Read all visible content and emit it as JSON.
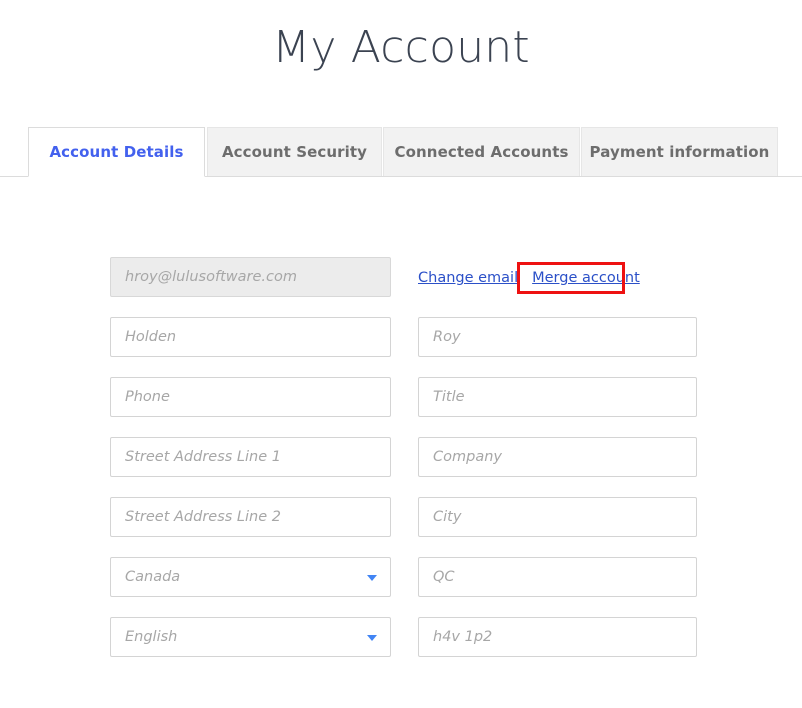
{
  "page": {
    "title": "My Account"
  },
  "tabs": [
    {
      "label": "Account Details",
      "active": true
    },
    {
      "label": "Account Security",
      "active": false
    },
    {
      "label": "Connected Accounts",
      "active": false
    },
    {
      "label": "Payment information",
      "active": false
    }
  ],
  "account_form": {
    "email_field": {
      "placeholder": "hroy@lulusoftware.com",
      "value": "",
      "disabled": true
    },
    "links": {
      "change_email": "Change email",
      "merge_account": "Merge account"
    },
    "left_column": [
      {
        "name": "first-name",
        "placeholder": "Holden",
        "value": "",
        "type": "text"
      },
      {
        "name": "phone",
        "placeholder": "Phone",
        "value": "",
        "type": "text"
      },
      {
        "name": "street-address-1",
        "placeholder": "Street Address Line 1",
        "value": "",
        "type": "text"
      },
      {
        "name": "street-address-2",
        "placeholder": "Street Address Line 2",
        "value": "",
        "type": "text"
      },
      {
        "name": "country",
        "placeholder": "Canada",
        "value": "",
        "type": "select"
      },
      {
        "name": "language",
        "placeholder": "English",
        "value": "",
        "type": "select"
      }
    ],
    "right_column": [
      {
        "name": "last-name",
        "placeholder": "Roy",
        "value": "",
        "type": "text"
      },
      {
        "name": "title",
        "placeholder": "Title",
        "value": "",
        "type": "text"
      },
      {
        "name": "company",
        "placeholder": "Company",
        "value": "",
        "type": "text"
      },
      {
        "name": "city",
        "placeholder": "City",
        "value": "",
        "type": "text"
      },
      {
        "name": "province",
        "placeholder": "QC",
        "value": "",
        "type": "text"
      },
      {
        "name": "postal-code",
        "placeholder": "h4v 1p2",
        "value": "",
        "type": "text"
      }
    ]
  },
  "annotation": {
    "target": "merge-account-link",
    "color": "#ee1111"
  },
  "colors": {
    "active_tab_text": "#4361ee",
    "inactive_tab_text": "#6d6d6d",
    "inactive_tab_bg": "#f2f2f2",
    "link": "#2b50c8",
    "placeholder": "#a7a7a7",
    "title": "#3b4351",
    "caret": "#4285f4",
    "highlight": "#ee1111"
  }
}
